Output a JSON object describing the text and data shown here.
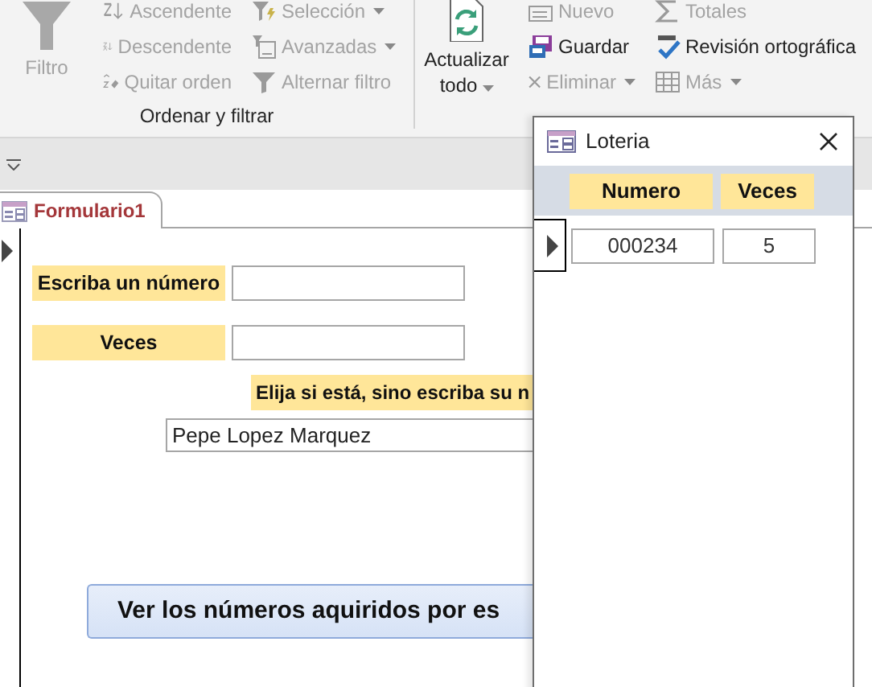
{
  "ribbon": {
    "groups": [
      {
        "label": "Ordenar y filtrar",
        "large": {
          "label": "Filtro",
          "disabled": true,
          "dropdown": false
        },
        "columns": [
          [
            {
              "label": "Ascendente",
              "disabled": true,
              "dropdown": false
            },
            {
              "label": "Descendente",
              "disabled": true,
              "dropdown": false
            },
            {
              "label": "Quitar orden",
              "disabled": true,
              "dropdown": false
            }
          ],
          [
            {
              "label": "Selección",
              "disabled": true,
              "dropdown": true
            },
            {
              "label": "Avanzadas",
              "disabled": true,
              "dropdown": true
            },
            {
              "label": "Alternar filtro",
              "disabled": true,
              "dropdown": false
            }
          ]
        ]
      },
      {
        "large": {
          "label": "Actualizar todo",
          "disabled": false,
          "dropdown": true
        },
        "columns": [
          [
            {
              "label": "Nuevo",
              "disabled": true,
              "dropdown": false
            },
            {
              "label": "Guardar",
              "disabled": false,
              "dropdown": false
            },
            {
              "label": "Eliminar",
              "disabled": true,
              "dropdown": true
            }
          ],
          [
            {
              "label": "Totales",
              "disabled": true,
              "dropdown": false
            },
            {
              "label": "Revisión ortográfica",
              "disabled": false,
              "dropdown": false
            },
            {
              "label": "Más",
              "disabled": true,
              "dropdown": true
            }
          ]
        ]
      }
    ]
  },
  "form": {
    "tab": "Formulario1",
    "fields": [
      {
        "label": "Escriba un número"
      },
      {
        "label": "Veces"
      }
    ],
    "name_prompt": "Elija si está, sino escriba su n",
    "name_combo": {
      "value": "Pepe Lopez Marquez"
    },
    "button": "Ver los números aquiridos por es"
  },
  "popup": {
    "title": "Loteria",
    "columns": [
      "Numero",
      "Veces"
    ],
    "rows": [
      [
        "000234",
        "5"
      ]
    ]
  }
}
